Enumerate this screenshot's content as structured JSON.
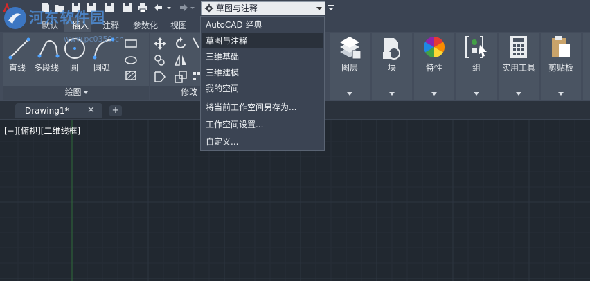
{
  "workspace": {
    "current": "草图与注释",
    "options": [
      "AutoCAD 经典",
      "草图与注释",
      "三维基础",
      "三维建模",
      "我的空间"
    ],
    "actions": [
      "将当前工作空间另存为...",
      "工作空间设置...",
      "自定义..."
    ]
  },
  "tabs": [
    "默认",
    "插入",
    "注释",
    "参数化",
    "视图"
  ],
  "panels": {
    "draw": {
      "title": "绘图",
      "tools": [
        "直线",
        "多段线",
        "圆",
        "圆弧"
      ]
    },
    "modify": {
      "title": "修改"
    },
    "layers": "图层",
    "block": "块",
    "properties": "特性",
    "group": "组",
    "utilities": "实用工具",
    "clipboard": "剪贴板"
  },
  "document_tab": {
    "name": "Drawing1*",
    "close": "✕",
    "new": "+"
  },
  "viewport": {
    "label": "[−][俯视][二维线框]"
  },
  "watermark": {
    "title": "河东软件园",
    "url": "www.pc0359.cn"
  },
  "colors": {
    "background": "#212830",
    "ribbon": "#434c5b",
    "menu": "#3b4453",
    "highlight": "#2a313b",
    "accent": "#4f8fd8"
  }
}
